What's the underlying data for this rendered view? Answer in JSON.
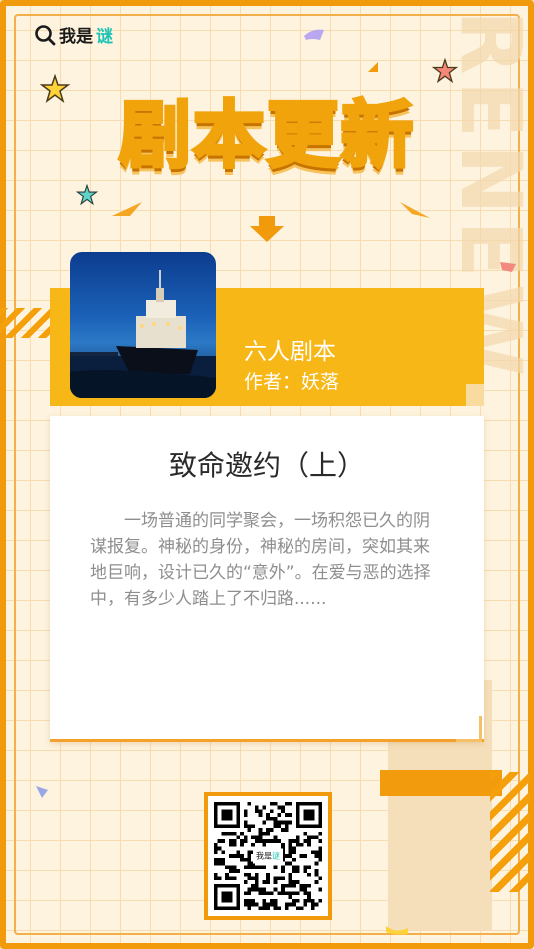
{
  "brand": {
    "name_part1": "我是",
    "name_part2": "谜"
  },
  "watermark": "RENEW",
  "headline": "剧本更新",
  "script": {
    "type": "六人剧本",
    "author": "作者：妖落",
    "title": "致命邀约（上）",
    "description": "一场普通的同学聚会，一场积怨已久的阴谋报复。神秘的身份，神秘的房间，突如其来地巨响，设计已久的“意外”。在爱与恶的选择中，有多少人踏上了不归路......"
  },
  "qr": {
    "center_part1": "我是",
    "center_part2": "谜"
  },
  "colors": {
    "accent": "#f19a0c",
    "band": "#f7b716",
    "headline": "#ffc51a",
    "brand_teal": "#1ec4b4",
    "background": "#fdf3df"
  }
}
